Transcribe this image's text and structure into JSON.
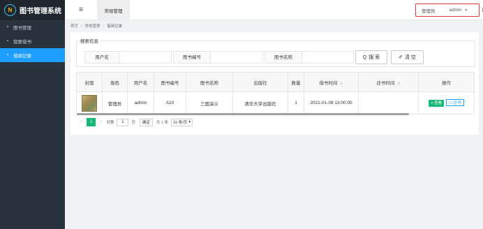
{
  "app": {
    "logo_letter": "N",
    "title": "图书管理系统"
  },
  "sidebar": {
    "items": [
      {
        "label": "图书管理",
        "icon": "book-icon"
      },
      {
        "label": "我要借书",
        "icon": "book-icon"
      },
      {
        "label": "借阅记录",
        "icon": "book-icon",
        "active": true
      }
    ]
  },
  "header": {
    "menu_icon": "☰",
    "tab_label": "常规管理",
    "user_role": "管理员",
    "user_name": "admin",
    "caret": "▼"
  },
  "breadcrumb": [
    "首页",
    "常规管理",
    "借阅记录"
  ],
  "breadcrumb_sep": "/",
  "search": {
    "legend": "搜索信息",
    "fields": [
      {
        "label": "用户名",
        "value": ""
      },
      {
        "label": "图书编号",
        "value": ""
      },
      {
        "label": "图书名称",
        "value": ""
      }
    ],
    "search_icon": "Q",
    "search_label": "搜 索",
    "clear_icon": "✐",
    "clear_label": "清 空"
  },
  "table": {
    "columns": [
      "封面",
      "角色",
      "用户名",
      "图书编号",
      "图书名称",
      "出版社",
      "数量",
      "借书时间",
      "还书时间",
      "操作"
    ],
    "sort_glyph": "⇕",
    "rows": [
      {
        "role": "管理员",
        "username": "admin",
        "book_id": "A10",
        "book_name": "三国演义",
        "publisher": "清华大学出版社",
        "quantity": "1",
        "borrow_time": "2021-01-08 13:00:00",
        "return_time": "",
        "view_label": "< 查看",
        "return_label": "☐ 还书"
      }
    ]
  },
  "pager": {
    "prev": "<",
    "current": "1",
    "next": ">",
    "goto_label": "到第",
    "goto_value": "1",
    "page_unit": "页",
    "confirm": "确定",
    "total": "共 1 条",
    "per_page": "15 条/页",
    "per_page_caret": "▾"
  },
  "colors": {
    "accent": "#1e9fff",
    "success": "#16b777",
    "sidebar": "#28333e",
    "highlight_box": "#e53935"
  }
}
